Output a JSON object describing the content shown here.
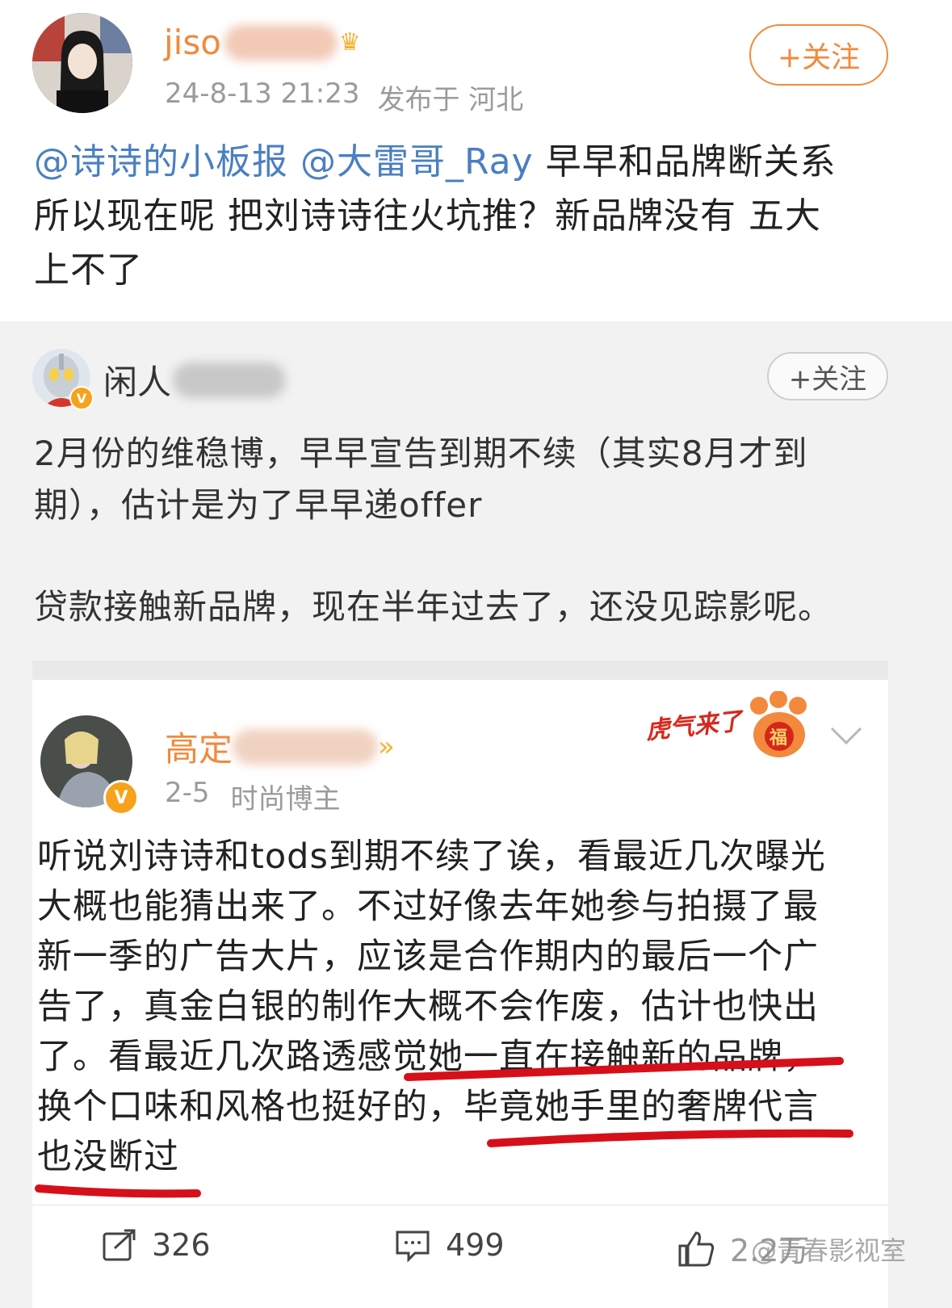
{
  "post": {
    "author_name": "jiso",
    "time": "24-8-13 21:23",
    "location": "发布于 河北",
    "follow_label": "+关注",
    "mention1": "@诗诗的小板报",
    "mention2": "@大雷哥_Ray",
    "text_line1": "早早和品牌断关系",
    "text_line2": "所以现在呢 把刘诗诗往火坑推？新品牌没有 五大",
    "text_line3": "上不了"
  },
  "repost": {
    "author_name": "闲人",
    "follow_label": "+关注",
    "para1_line1": "2月份的维稳博，早早宣告到期不续（其实8月才到",
    "para1_line2": "期），估计是为了早早递offer",
    "para2": "贷款接触新品牌，现在半年过去了，还没见踪影呢。"
  },
  "original": {
    "author_name": "高定",
    "date": "2-5",
    "role": "时尚博主",
    "badge_text": "虎气来了",
    "badge_fu": "福",
    "lines": [
      "听说刘诗诗和tods到期不续了诶，看最近几次曝光",
      "大概也能猜出来了。不过好像去年她参与拍摄了最",
      "新一季的广告大片，应该是合作期内的最后一个广",
      "告了，真金白银的制作大概不会作废，估计也快出",
      "了。看最近几次路透感觉她一直在接触新的品牌，",
      "换个口味和风格也挺好的，毕竟她手里的奢牌代言",
      "也没断过"
    ]
  },
  "actions": {
    "repost_count": "326",
    "comment_count": "499",
    "like_count": "2.2万"
  },
  "watermark": "@青春影视室"
}
